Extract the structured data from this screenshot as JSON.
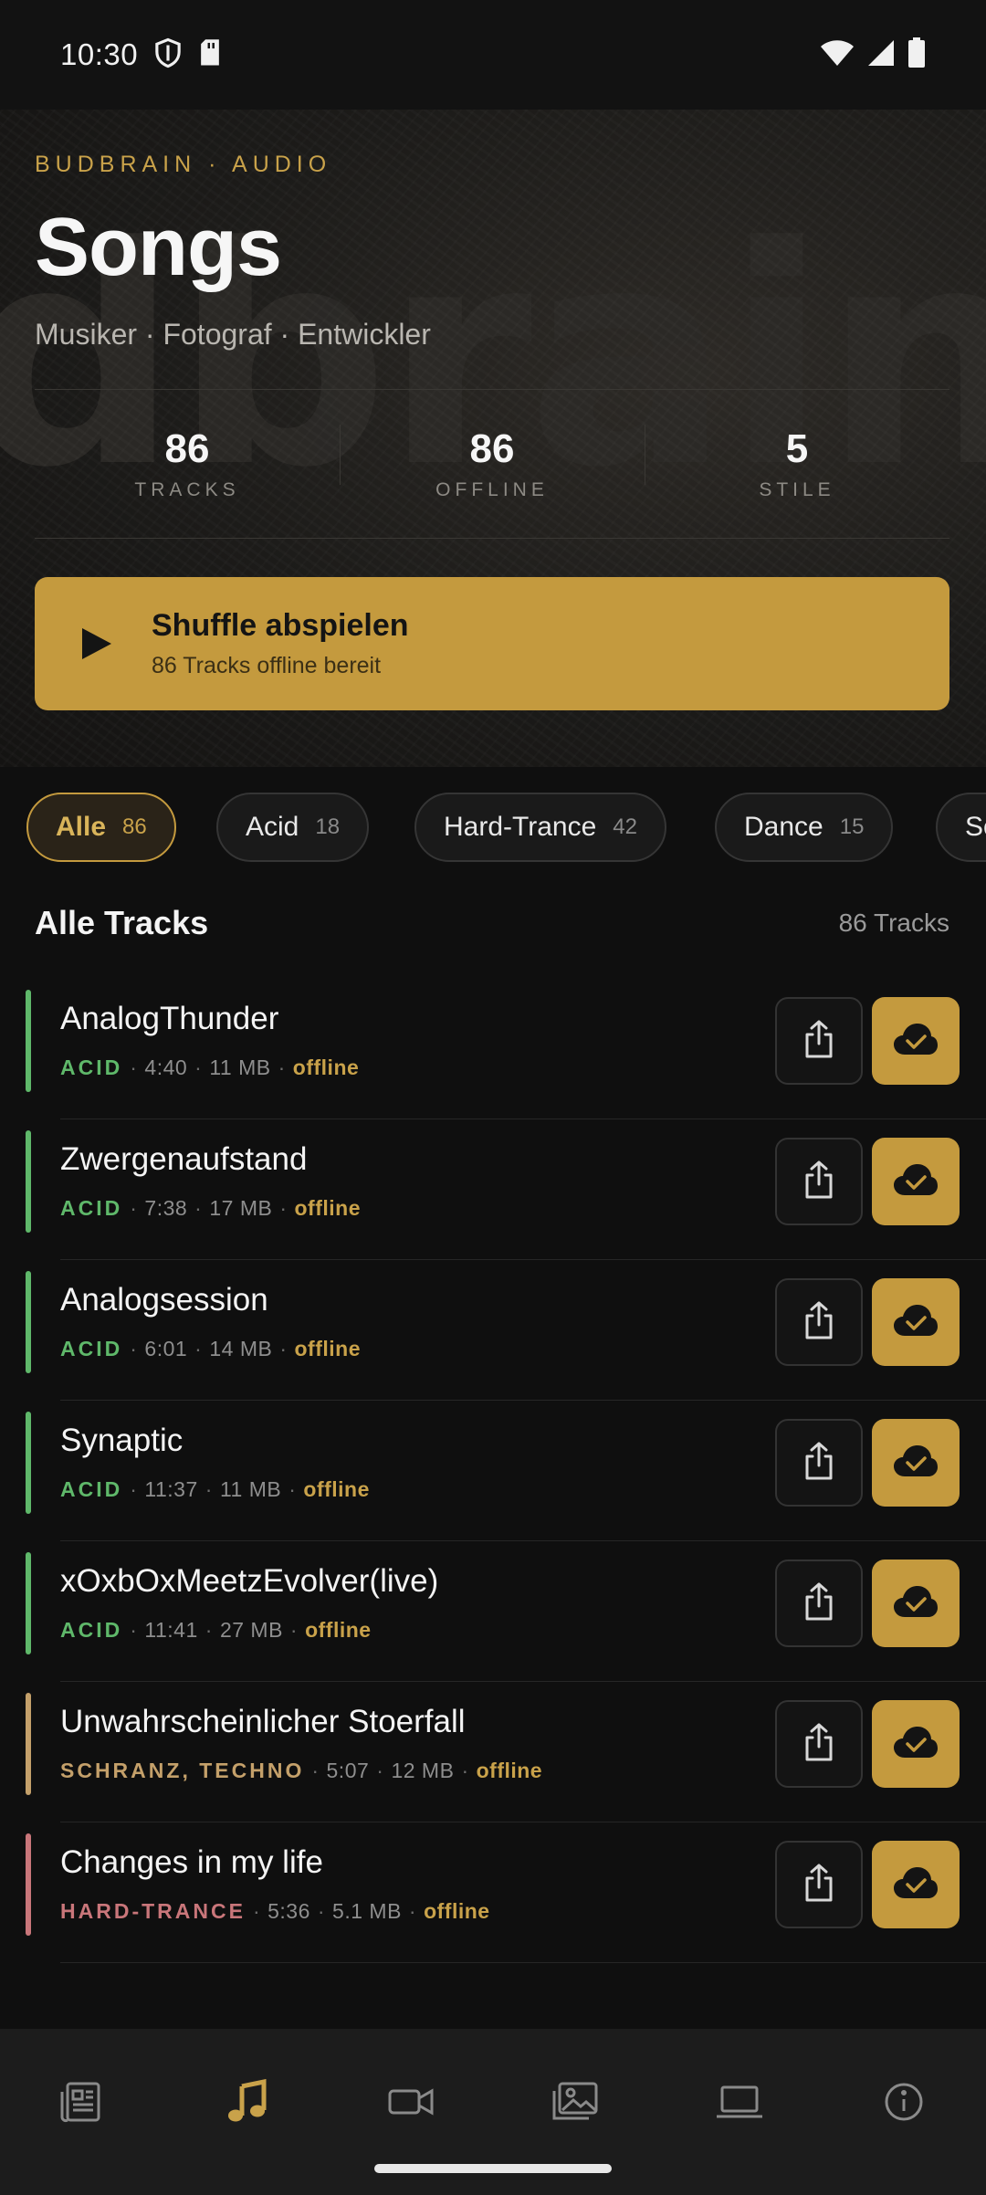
{
  "status_bar": {
    "time": "10:30"
  },
  "hero": {
    "eyebrow": "BUDBRAIN · AUDIO",
    "watermark": "dbrain",
    "title": "Songs",
    "subtitle": "Musiker · Fotograf · Entwickler",
    "stats": [
      {
        "value": "86",
        "label": "TRACKS"
      },
      {
        "value": "86",
        "label": "OFFLINE"
      },
      {
        "value": "5",
        "label": "STILE"
      }
    ],
    "shuffle": {
      "title": "Shuffle abspielen",
      "subtitle": "86 Tracks offline bereit"
    }
  },
  "filters": [
    {
      "label": "Alle",
      "count": "86",
      "active": true
    },
    {
      "label": "Acid",
      "count": "18"
    },
    {
      "label": "Hard-Trance",
      "count": "42"
    },
    {
      "label": "Dance",
      "count": "15"
    },
    {
      "label": "Sc",
      "count": ""
    }
  ],
  "list": {
    "title": "Alle Tracks",
    "count_label": "86 Tracks"
  },
  "tracks": [
    {
      "title": "AnalogThunder",
      "style": "ACID",
      "duration": "4:40",
      "size": "11 MB",
      "status": "offline",
      "color": "#5fb86a"
    },
    {
      "title": "Zwergenaufstand",
      "style": "ACID",
      "duration": "7:38",
      "size": "17 MB",
      "status": "offline",
      "color": "#5fb86a"
    },
    {
      "title": "Analogsession",
      "style": "ACID",
      "duration": "6:01",
      "size": "14 MB",
      "status": "offline",
      "color": "#5fb86a"
    },
    {
      "title": "Synaptic",
      "style": "ACID",
      "duration": "11:37",
      "size": "11 MB",
      "status": "offline",
      "color": "#5fb86a"
    },
    {
      "title": "xOxbOxMeetzEvolver(live)",
      "style": "ACID",
      "duration": "11:41",
      "size": "27 MB",
      "status": "offline",
      "color": "#5fb86a"
    },
    {
      "title": "Unwahrscheinlicher Stoerfall",
      "style": "SCHRANZ, TECHNO",
      "duration": "5:07",
      "size": "12 MB",
      "status": "offline",
      "color": "#c4a06a"
    },
    {
      "title": "Changes in my life",
      "style": "HARD-TRANCE",
      "duration": "5:36",
      "size": "5.1 MB",
      "status": "offline",
      "color": "#c9767a"
    }
  ],
  "nav": [
    {
      "icon": "news-icon"
    },
    {
      "icon": "music-note-icon",
      "active": true
    },
    {
      "icon": "video-camera-icon"
    },
    {
      "icon": "gallery-icon"
    },
    {
      "icon": "laptop-icon"
    },
    {
      "icon": "info-icon"
    }
  ],
  "colors": {
    "accent": "#c49a3e",
    "background": "#0f0f0f",
    "acid": "#5fb86a",
    "schranz": "#c4a06a",
    "hardtrance": "#c9767a"
  }
}
